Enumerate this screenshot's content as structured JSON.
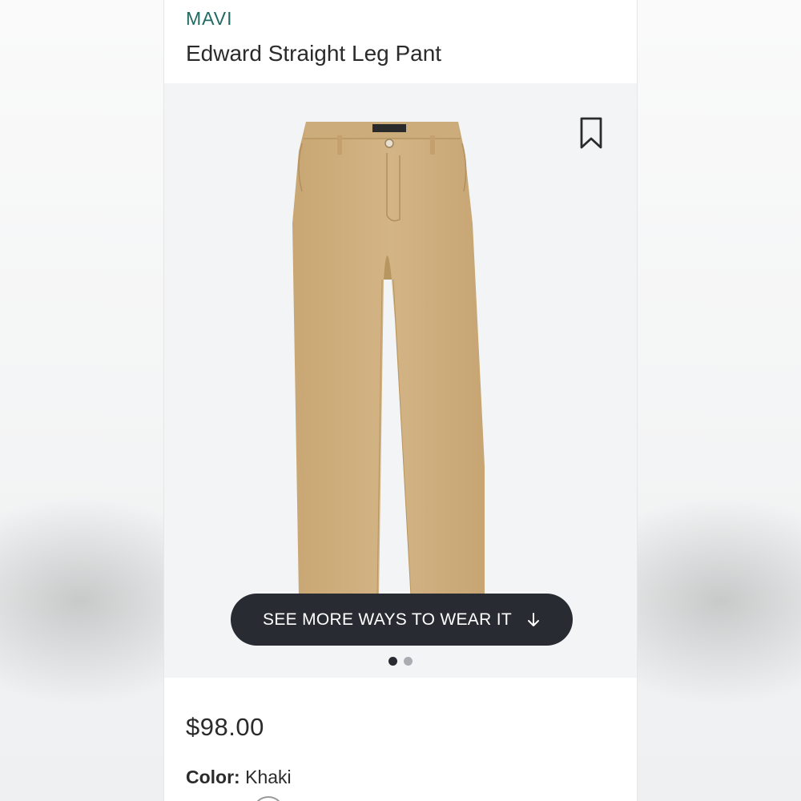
{
  "product": {
    "brand": "MAVI",
    "title": "Edward Straight Leg Pant",
    "price": "$98.00",
    "color_label": "Color:",
    "color_value": "Khaki"
  },
  "gallery": {
    "cta_label": "SEE MORE WAYS TO WEAR IT",
    "cta_icon": "arrow-down-icon",
    "bookmark_icon": "bookmark-icon",
    "image_count": 2,
    "active_index": 0
  },
  "colors": {
    "brand": "#1f6b62",
    "cta_bg": "#282c32",
    "khaki": "#cfae7e"
  }
}
